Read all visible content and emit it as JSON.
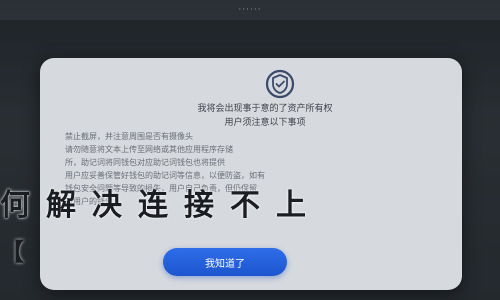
{
  "status_bar": {
    "title": "······"
  },
  "dialog": {
    "icon": "shield-check-icon",
    "heading_line1": "我将会出现事于意的了资产所有权",
    "heading_line2": "用户须注意以下事项",
    "body_lines": [
      "禁止截屏，并注意周围是否有摄像头",
      "请勿随意将文本上传至网络或其他应用程序存储",
      "所，助记词将同钱包对应助记词钱包也将提供",
      "用户应妥善保管好钱包的助记词等信息，以便防盗，如有",
      "钱包安全问题等导致的损失，用户自己负责，但仍保留",
      "对用户的钱包，"
    ],
    "confirm_label": "我知道了",
    "accent_color": "#2463e0"
  },
  "watermark": {
    "text": "何解决连接不上",
    "bracket": "【"
  }
}
